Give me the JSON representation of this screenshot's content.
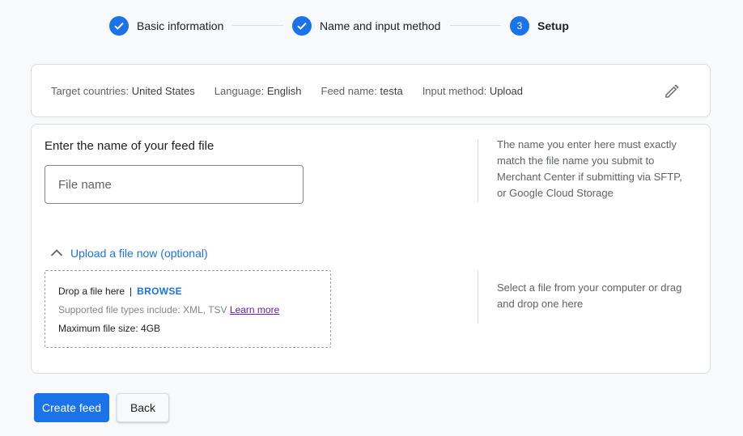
{
  "stepper": {
    "steps": [
      {
        "label": "Basic information",
        "state": "complete"
      },
      {
        "label": "Name and input method",
        "state": "complete"
      },
      {
        "label": "Setup",
        "state": "active",
        "number": "3"
      }
    ]
  },
  "summary": {
    "target_countries_key": "Target countries:",
    "target_countries_value": "United States",
    "language_key": "Language:",
    "language_value": "English",
    "feed_name_key": "Feed name:",
    "feed_name_value": "testa",
    "input_method_key": "Input method:",
    "input_method_value": "Upload",
    "edit_icon": "pencil-icon"
  },
  "feed_file": {
    "title": "Enter the name of your feed file",
    "input_placeholder": "File name",
    "input_value": "",
    "help_text": "The name you enter here must exactly match the file name you submit to Merchant Center if submitting via SFTP, or Google Cloud Storage"
  },
  "upload": {
    "toggle_label": "Upload a file now (optional)",
    "toggle_icon": "chevron-up-icon",
    "drop_text": "Drop a file here",
    "separator": "|",
    "browse_label": "BROWSE",
    "supported_text": "Supported file types include: XML, TSV",
    "learn_more_label": "Learn more",
    "max_size_text": "Maximum file size: 4GB",
    "help_text": "Select a file from your computer or drag and drop one here"
  },
  "actions": {
    "create_label": "Create feed",
    "back_label": "Back"
  },
  "colors": {
    "accent": "#1a73e8",
    "link_visited": "#681da8"
  }
}
